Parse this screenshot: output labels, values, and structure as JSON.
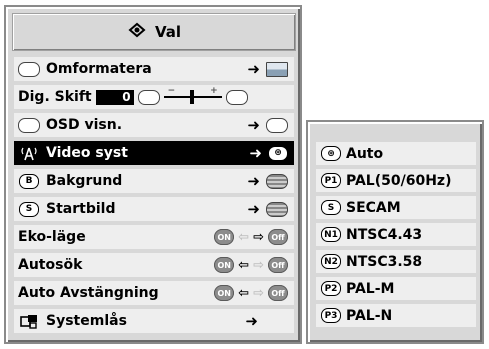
{
  "main": {
    "title": "Val",
    "title_icon": "settings-icon",
    "items": [
      {
        "label": "Omformatera",
        "icon": "reformat-icon",
        "control": "submenu"
      },
      {
        "label": "Dig. Skift",
        "icon": "",
        "value": "0",
        "min_mark": "−",
        "max_mark": "+",
        "control": "slider"
      },
      {
        "label": "OSD visn.",
        "icon": "osd-icon",
        "control": "submenu"
      },
      {
        "label": "Video syst",
        "icon": "antenna-icon",
        "control": "submenu",
        "selected": true
      },
      {
        "label": "Bakgrund",
        "icon": "b-icon",
        "control": "submenu"
      },
      {
        "label": "Startbild",
        "icon": "s-icon",
        "control": "submenu"
      },
      {
        "label": "Eko-läge",
        "state_left": "ON",
        "state_right": "Off",
        "active": "right",
        "control": "toggle"
      },
      {
        "label": "Autosök",
        "state_left": "ON",
        "state_right": "Off",
        "active": "left",
        "control": "toggle"
      },
      {
        "label": "Auto Avstängning",
        "state_left": "ON",
        "state_right": "Off",
        "active": "left",
        "control": "toggle"
      },
      {
        "label": "Systemlås",
        "icon": "system-lock-icon",
        "control": "submenu"
      }
    ]
  },
  "submenu": {
    "options": [
      {
        "label": "Auto",
        "badge": "⊛"
      },
      {
        "label": "PAL(50/60Hz)",
        "badge": "P1"
      },
      {
        "label": "SECAM",
        "badge": "S"
      },
      {
        "label": "NTSC4.43",
        "badge": "N1"
      },
      {
        "label": "NTSC3.58",
        "badge": "N2"
      },
      {
        "label": "PAL-M",
        "badge": "P2"
      },
      {
        "label": "PAL-N",
        "badge": "P3"
      }
    ]
  },
  "colors": {
    "panel": "#d8d8d8",
    "row": "#eeeeee",
    "selected": "#000000"
  }
}
